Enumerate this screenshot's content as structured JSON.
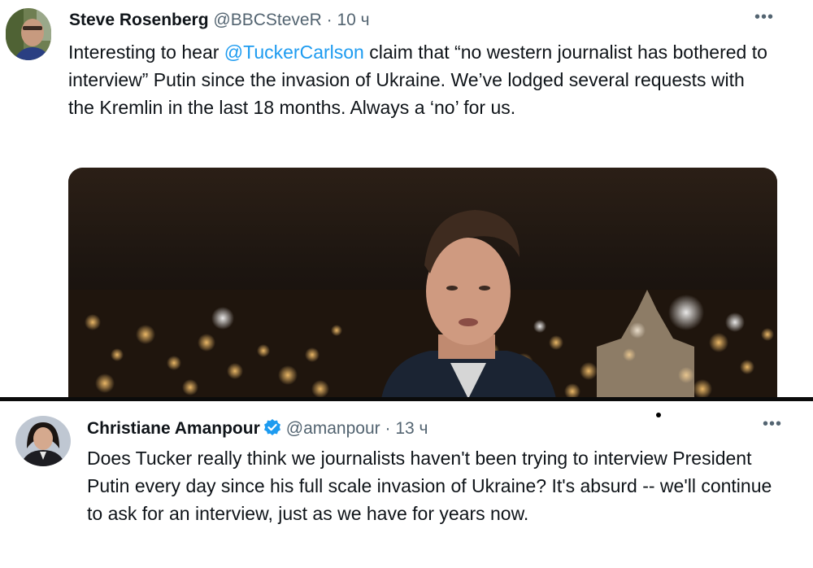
{
  "tweets": [
    {
      "author": {
        "name": "Steve Rosenberg",
        "handle": "@BBCSteveR",
        "avatar_icon": "avatar-photo-icon"
      },
      "separator": "·",
      "time": "10 ч",
      "more_label": "•••",
      "text_before_mention": "Interesting to hear ",
      "mention": "@TuckerCarlson",
      "text_after_mention": " claim that “no western journalist has bothered to interview” Putin since the invasion of Ukraine. We’ve lodged several requests with the Kremlin in the last 18 months. Always a ‘no’ for us."
    },
    {
      "author": {
        "name": "Christiane Amanpour",
        "handle": "@amanpour",
        "verified": true,
        "avatar_icon": "avatar-photo-icon"
      },
      "separator": "·",
      "time": "13 ч",
      "more_label": "•••",
      "text": "Does Tucker really think we journalists haven't been trying to interview President Putin every day since his full scale invasion of Ukraine? It's absurd -- we'll continue to ask for an interview, just as we have for years now."
    }
  ],
  "colors": {
    "link": "#1d9bf0",
    "muted": "#536471",
    "verified_badge": "#1d9bf0"
  }
}
